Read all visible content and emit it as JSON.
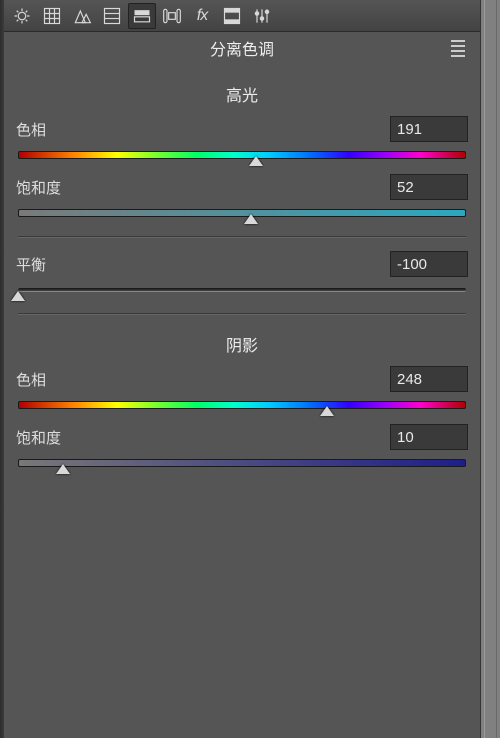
{
  "toolbar": {
    "tools": [
      {
        "name": "basic-icon",
        "active": false
      },
      {
        "name": "tone-curve-icon",
        "active": false
      },
      {
        "name": "detail-icon",
        "active": false
      },
      {
        "name": "hsl-icon",
        "active": false
      },
      {
        "name": "split-tone-icon",
        "active": true
      },
      {
        "name": "lens-icon",
        "active": false
      },
      {
        "name": "fx-icon",
        "active": false
      },
      {
        "name": "calibration-icon",
        "active": false
      },
      {
        "name": "presets-icon",
        "active": false
      }
    ]
  },
  "panel": {
    "title": "分离色调",
    "highlights": {
      "heading": "高光",
      "hue": {
        "label": "色相",
        "value": "191",
        "min": 0,
        "max": 360
      },
      "saturation": {
        "label": "饱和度",
        "value": "52",
        "min": 0,
        "max": 100
      }
    },
    "balance": {
      "label": "平衡",
      "value": "-100",
      "min": -100,
      "max": 100
    },
    "shadows": {
      "heading": "阴影",
      "hue": {
        "label": "色相",
        "value": "248",
        "min": 0,
        "max": 360
      },
      "saturation": {
        "label": "饱和度",
        "value": "10",
        "min": 0,
        "max": 100
      }
    }
  }
}
